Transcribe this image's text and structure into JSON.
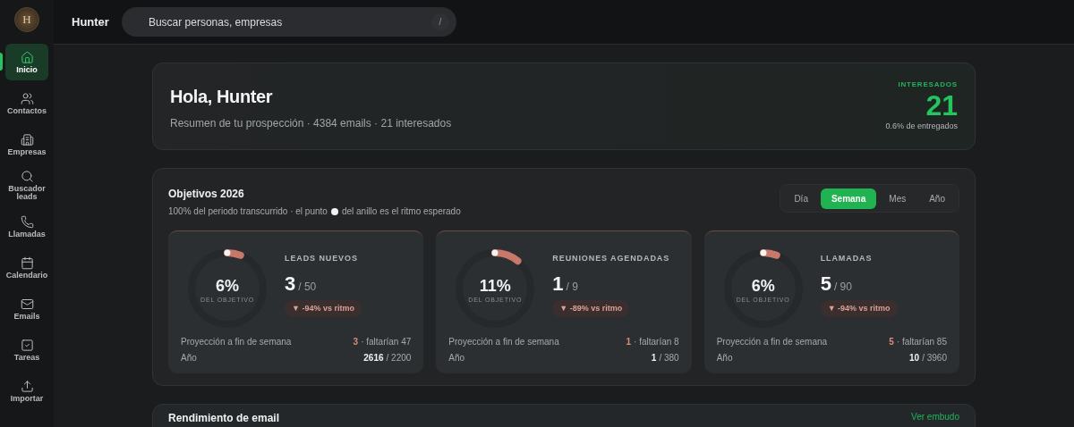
{
  "sidebar": {
    "logo_letter": "H",
    "items": [
      {
        "label": "Inicio",
        "selected": true
      },
      {
        "label": "Contactos",
        "selected": false
      },
      {
        "label": "Empresas",
        "selected": false
      },
      {
        "label": "Buscador leads",
        "selected": false
      },
      {
        "label": "Llamadas",
        "selected": false
      },
      {
        "label": "Calendario",
        "selected": false
      },
      {
        "label": "Emails",
        "selected": false
      },
      {
        "label": "Tareas",
        "selected": false
      },
      {
        "label": "Importar",
        "selected": false
      }
    ]
  },
  "header": {
    "title": "Hunter",
    "search": {
      "placeholder": "Buscar personas, empresas",
      "shortcut": "/"
    }
  },
  "hero": {
    "title": "Hola, Hunter",
    "subtitle": "Resumen de tu prospección · 4384 emails · 21 interesados",
    "stat_label": "INTERESADOS",
    "stat_value": "21",
    "stat_note": "0.6% de entregados"
  },
  "objectives": {
    "title": "Objetivos 2026",
    "subtitle_before": "100% del periodo transcurrido · el punto",
    "subtitle_after": "del anillo es el ritmo esperado",
    "tabs": [
      {
        "label": "Día",
        "selected": false
      },
      {
        "label": "Semana",
        "selected": true
      },
      {
        "label": "Mes",
        "selected": false
      },
      {
        "label": "Año",
        "selected": false
      }
    ],
    "metrics": [
      {
        "percent": "6%",
        "percent_label": "DEL OBJETIVO",
        "name": "LEADS NUEVOS",
        "value": "3",
        "target": "/ 50",
        "delta": "▼ -94% vs ritmo",
        "projection_label": "Proyección a fin de semana",
        "projection_value": "3",
        "projection_note": "· faltarían 47",
        "year_label": "Año",
        "year_value": "2616",
        "year_target": "/ 2200"
      },
      {
        "percent": "11%",
        "percent_label": "DEL OBJETIVO",
        "name": "REUNIONES AGENDADAS",
        "value": "1",
        "target": "/ 9",
        "delta": "▼ -89% vs ritmo",
        "projection_label": "Proyección a fin de semana",
        "projection_value": "1",
        "projection_note": "· faltarían 8",
        "year_label": "Año",
        "year_value": "1",
        "year_target": "/ 380"
      },
      {
        "percent": "6%",
        "percent_label": "DEL OBJETIVO",
        "name": "LLAMADAS",
        "value": "5",
        "target": "/ 90",
        "delta": "▼ -94% vs ritmo",
        "projection_label": "Proyección a fin de semana",
        "projection_value": "5",
        "projection_note": "· faltarían 85",
        "year_label": "Año",
        "year_value": "10",
        "year_target": "/ 3960"
      }
    ]
  },
  "email_performance": {
    "title": "Rendimiento de email",
    "link": "Ver embudo"
  }
}
